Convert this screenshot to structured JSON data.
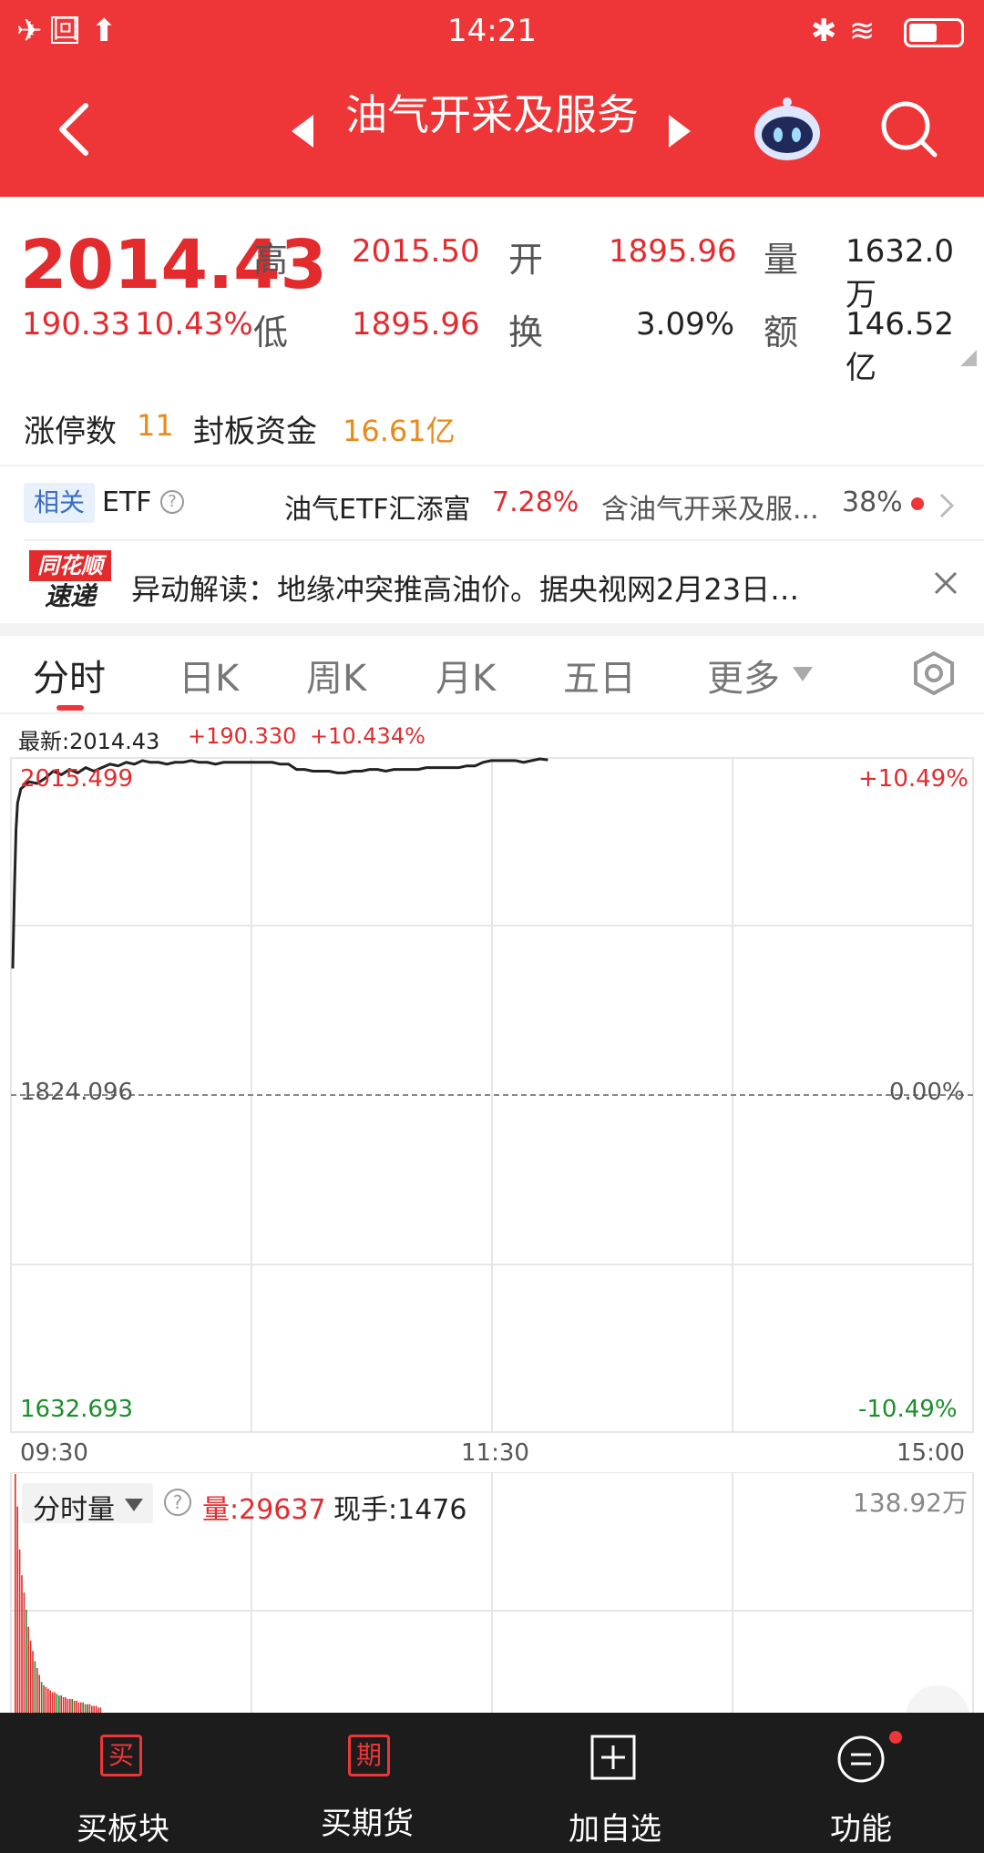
{
  "status_bar": {
    "time": "14:21"
  },
  "header": {
    "title": "油气开采及服务"
  },
  "quote": {
    "price": "2014.43",
    "change": "190.33",
    "change_pct": "10.43%",
    "high_label": "高",
    "high": "2015.50",
    "low_label": "低",
    "low": "1895.96",
    "open_label": "开",
    "open": "1895.96",
    "turnover_label": "换",
    "turnover": "3.09%",
    "volume_label": "量",
    "volume": "1632.0万",
    "amount_label": "额",
    "amount": "146.52亿"
  },
  "limit_up": {
    "count_label": "涨停数",
    "count": "11",
    "fund_label": "封板资金",
    "fund": "16.61亿"
  },
  "etf": {
    "tag": "相关",
    "label": "ETF",
    "name": "油气ETF汇添富",
    "pct": "7.28%",
    "contains": "含油气开采及服...",
    "weight": "38%"
  },
  "news": {
    "logo_top": "同花顺",
    "logo_bottom": "速递",
    "text": "异动解读：地缘冲突推高油价。据央视网2月23日…"
  },
  "tabs": [
    {
      "label": "分时"
    },
    {
      "label": "日K"
    },
    {
      "label": "周K"
    },
    {
      "label": "月K"
    },
    {
      "label": "五日"
    },
    {
      "label": "更多"
    }
  ],
  "intraday": {
    "latest_label": "最新:2014.43",
    "chg": "+190.330",
    "chg_pct": "+10.434%",
    "y_top": "2015.499",
    "y_mid": "1824.096",
    "y_bottom": "1632.693",
    "pct_top": "+10.49%",
    "pct_mid": "0.00%",
    "pct_bottom": "-10.49%",
    "time_start": "09:30",
    "time_mid": "11:30",
    "time_end": "15:00"
  },
  "volume_panel": {
    "selector": "分时量",
    "vol": "量:29637",
    "current": "现手:1476",
    "max": "138.92万"
  },
  "bottom_nav": [
    {
      "label": "买板块",
      "icon": "买"
    },
    {
      "label": "买期货",
      "icon": "期"
    },
    {
      "label": "加自选"
    },
    {
      "label": "功能"
    }
  ],
  "chart_data": {
    "type": "line",
    "x": [
      0,
      2,
      4,
      6,
      10,
      15,
      20,
      30,
      40,
      50,
      60,
      70,
      80,
      90,
      100,
      110,
      120,
      130,
      140,
      150,
      160,
      170,
      180,
      190,
      200,
      210,
      220,
      230,
      240,
      250,
      260,
      270,
      280,
      290,
      300,
      310,
      320,
      330,
      340,
      350,
      360,
      370,
      380,
      390,
      400,
      410,
      420,
      430,
      440,
      450,
      460,
      470,
      480,
      490,
      500,
      510,
      520,
      530,
      540,
      550,
      560,
      570,
      580,
      590,
      600,
      610,
      620,
      630,
      640,
      650,
      660
    ],
    "y": [
      1895.96,
      1940,
      1975,
      1990,
      1998,
      2000,
      2002,
      2001,
      2004,
      2008,
      2006,
      2009,
      2007,
      2010,
      2008,
      2010,
      2012,
      2011,
      2013,
      2012,
      2014,
      2013,
      2013,
      2012,
      2013,
      2013,
      2014,
      2013,
      2013,
      2012,
      2013,
      2013,
      2013,
      2013,
      2013,
      2013,
      2013,
      2012,
      2012,
      2009,
      2009,
      2008,
      2008,
      2008,
      2007,
      2007,
      2008,
      2008,
      2009,
      2009,
      2008,
      2009,
      2009,
      2009,
      2009,
      2010,
      2010,
      2010,
      2010,
      2010,
      2011,
      2011,
      2013,
      2014,
      2014,
      2014,
      2014,
      2013,
      2014,
      2015,
      2014.43
    ],
    "ylim": [
      1632.693,
      2015.499
    ],
    "xlabel": "",
    "ylabel": "",
    "volume_values": [
      138.92,
      120,
      95,
      80,
      70,
      60,
      50,
      42,
      36,
      30,
      26,
      22,
      18,
      16,
      15,
      14,
      13,
      12,
      12,
      11,
      10,
      10,
      9,
      9,
      8,
      8,
      8,
      7,
      7,
      6,
      6,
      6,
      5,
      5,
      5,
      4,
      4,
      4,
      3,
      3
    ]
  },
  "colors": {
    "brand": "#ee3537",
    "up": "#e32b2e",
    "down": "#1b8e2a",
    "accent": "#e88a1a"
  }
}
